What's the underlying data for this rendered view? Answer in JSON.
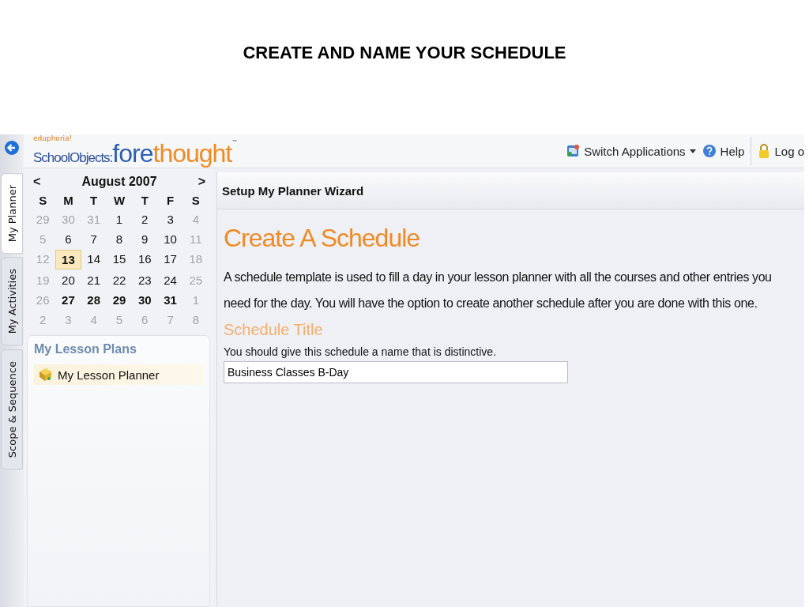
{
  "slide_title": "CREATE AND NAME YOUR SCHEDULE",
  "side_tabs": [
    {
      "label": "My Planner",
      "selected": true
    },
    {
      "label": "My Activities",
      "selected": false
    },
    {
      "label": "Scope & Sequence",
      "selected": false
    }
  ],
  "logo": {
    "tagline": "eduphoria!",
    "product": "SchoolObjects:",
    "name_part_1": "fore",
    "name_part_2": "thought",
    "mark": "™"
  },
  "header_actions": [
    {
      "label": "Switch Applications",
      "kind": "switch"
    },
    {
      "label": "Help",
      "kind": "help"
    },
    {
      "label": "Log o",
      "kind": "lock"
    }
  ],
  "calendar": {
    "prev": "<",
    "month": "August 2007",
    "next": ">",
    "weekdays": [
      "S",
      "M",
      "T",
      "W",
      "T",
      "F",
      "S"
    ],
    "weeks": [
      [
        {
          "day": "29",
          "muted": true,
          "bold": false,
          "selected": false
        },
        {
          "day": "30",
          "muted": true,
          "bold": false,
          "selected": false
        },
        {
          "day": "31",
          "muted": true,
          "bold": false,
          "selected": false
        },
        {
          "day": "1",
          "muted": false,
          "bold": false,
          "selected": false
        },
        {
          "day": "2",
          "muted": false,
          "bold": false,
          "selected": false
        },
        {
          "day": "3",
          "muted": false,
          "bold": false,
          "selected": false
        },
        {
          "day": "4",
          "muted": true,
          "bold": false,
          "selected": false
        }
      ],
      [
        {
          "day": "5",
          "muted": true,
          "bold": false,
          "selected": false
        },
        {
          "day": "6",
          "muted": false,
          "bold": false,
          "selected": false
        },
        {
          "day": "7",
          "muted": false,
          "bold": false,
          "selected": false
        },
        {
          "day": "8",
          "muted": false,
          "bold": false,
          "selected": false
        },
        {
          "day": "9",
          "muted": false,
          "bold": false,
          "selected": false
        },
        {
          "day": "10",
          "muted": false,
          "bold": false,
          "selected": false
        },
        {
          "day": "11",
          "muted": true,
          "bold": false,
          "selected": false
        }
      ],
      [
        {
          "day": "12",
          "muted": true,
          "bold": false,
          "selected": false
        },
        {
          "day": "13",
          "muted": false,
          "bold": true,
          "selected": true
        },
        {
          "day": "14",
          "muted": false,
          "bold": false,
          "selected": false
        },
        {
          "day": "15",
          "muted": false,
          "bold": false,
          "selected": false
        },
        {
          "day": "16",
          "muted": false,
          "bold": false,
          "selected": false
        },
        {
          "day": "17",
          "muted": false,
          "bold": false,
          "selected": false
        },
        {
          "day": "18",
          "muted": true,
          "bold": false,
          "selected": false
        }
      ],
      [
        {
          "day": "19",
          "muted": true,
          "bold": false,
          "selected": false
        },
        {
          "day": "20",
          "muted": false,
          "bold": false,
          "selected": false
        },
        {
          "day": "21",
          "muted": false,
          "bold": false,
          "selected": false
        },
        {
          "day": "22",
          "muted": false,
          "bold": false,
          "selected": false
        },
        {
          "day": "23",
          "muted": false,
          "bold": false,
          "selected": false
        },
        {
          "day": "24",
          "muted": false,
          "bold": false,
          "selected": false
        },
        {
          "day": "25",
          "muted": true,
          "bold": false,
          "selected": false
        }
      ],
      [
        {
          "day": "26",
          "muted": true,
          "bold": false,
          "selected": false
        },
        {
          "day": "27",
          "muted": false,
          "bold": true,
          "selected": false
        },
        {
          "day": "28",
          "muted": false,
          "bold": true,
          "selected": false
        },
        {
          "day": "29",
          "muted": false,
          "bold": true,
          "selected": false
        },
        {
          "day": "30",
          "muted": false,
          "bold": true,
          "selected": false
        },
        {
          "day": "31",
          "muted": false,
          "bold": true,
          "selected": false
        },
        {
          "day": "1",
          "muted": true,
          "bold": false,
          "selected": false
        }
      ],
      [
        {
          "day": "2",
          "muted": true,
          "bold": false,
          "selected": false
        },
        {
          "day": "3",
          "muted": true,
          "bold": false,
          "selected": false
        },
        {
          "day": "4",
          "muted": true,
          "bold": false,
          "selected": false
        },
        {
          "day": "5",
          "muted": true,
          "bold": false,
          "selected": false
        },
        {
          "day": "6",
          "muted": true,
          "bold": false,
          "selected": false
        },
        {
          "day": "7",
          "muted": true,
          "bold": false,
          "selected": false
        },
        {
          "day": "8",
          "muted": true,
          "bold": false,
          "selected": false
        }
      ]
    ]
  },
  "lesson_plans": {
    "heading": "My Lesson Plans",
    "items": [
      {
        "label": "My Lesson Planner",
        "selected": true
      }
    ]
  },
  "wizard": {
    "title": "Setup My Planner Wizard",
    "heading": "Create A Schedule",
    "intro": "A schedule template is used to fill a day in your lesson planner with all the courses and other entries you need for the day. You will have the option to create another schedule after you are done with this one.",
    "section": "Schedule Title",
    "hint": "You should give this schedule a name that is distinctive.",
    "value": "Business Classes B-Day"
  }
}
